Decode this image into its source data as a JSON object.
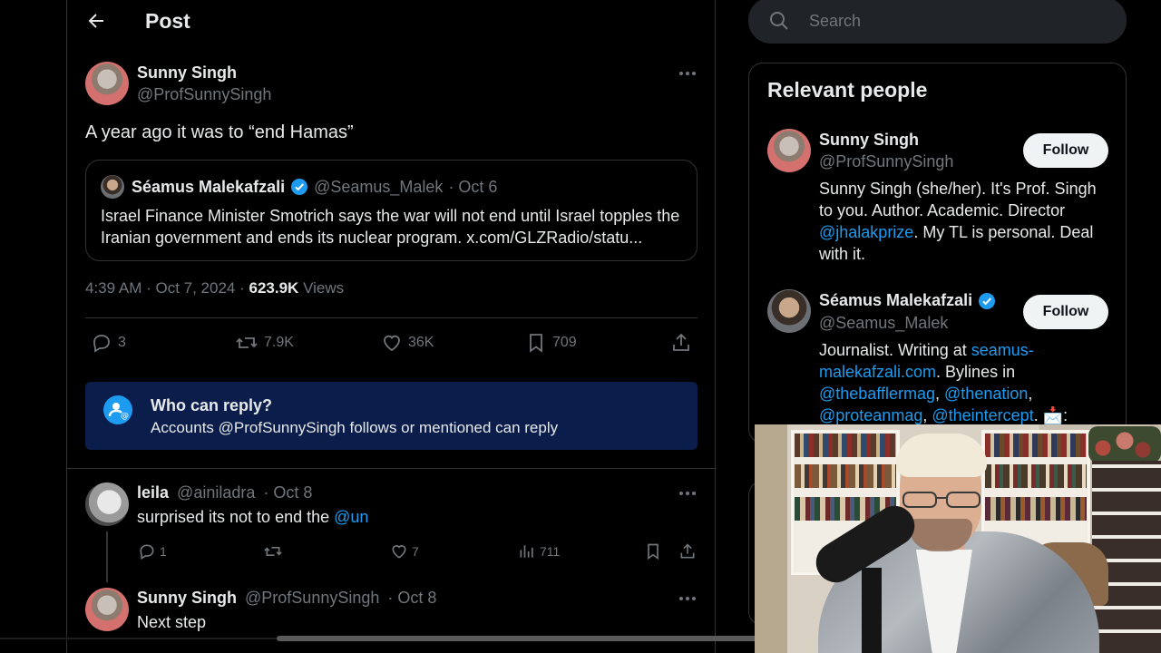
{
  "header": {
    "title": "Post"
  },
  "post": {
    "author_name": "Sunny Singh",
    "author_handle": "@ProfSunnySingh",
    "text": "A year ago it was to “end Hamas”",
    "quote": {
      "author_name": "Séamus Malekafzali",
      "author_handle": "@Seamus_Malek",
      "date": "· Oct 6",
      "text": "Israel Finance Minister Smotrich says the war will not end until Israel topples the Iranian government and ends its nuclear program. x.com/GLZRadio/statu..."
    },
    "time": "4:39 AM · Oct 7, 2024 ·",
    "views_count": "623.9K",
    "views_label": "Views",
    "stats": {
      "replies": "3",
      "reposts": "7.9K",
      "likes": "36K",
      "bookmarks": "709"
    }
  },
  "reply_restriction": {
    "title": "Who can reply?",
    "subtitle": "Accounts @ProfSunnySingh follows or mentioned can reply"
  },
  "replies": [
    {
      "name": "leila",
      "handle": "@ainiladra",
      "date": "· Oct 8",
      "text_prefix": "surprised its not to end the ",
      "mention": "@un",
      "stats": {
        "replies": "1",
        "reposts": "",
        "likes": "7",
        "views": "711"
      }
    },
    {
      "name": "Sunny Singh",
      "handle": "@ProfSunnySingh",
      "date": "· Oct 8",
      "text": "Next step"
    }
  ],
  "search": {
    "placeholder": "Search"
  },
  "relevant_people": {
    "title": "Relevant people",
    "follow_label": "Follow",
    "people": [
      {
        "name": "Sunny Singh",
        "handle": "@ProfSunnySingh",
        "bio_1": "Sunny Singh (she/her). It's Prof. Singh to you. Author. Academic. Director ",
        "bio_link": "@jhalakprize",
        "bio_2": ". My TL is personal. Deal with it."
      },
      {
        "name": "Séamus Malekafzali",
        "handle": "@Seamus_Malek",
        "bio_1": "Journalist. Writing at ",
        "bio_link": "seamus-malekafzali.com",
        "bio_2": ". Bylines in ",
        "bio_link_2": "@thebafflermag",
        "bio_sep_1": ", ",
        "bio_link_3": "@thenation",
        "bio_sep_2": ", ",
        "bio_link_4": "@proteanmag",
        "bio_sep_3": ", ",
        "bio_link_5": "@theintercept",
        "bio_3": ". 📩:"
      }
    ]
  },
  "colors": {
    "accent": "#1d9bf0",
    "background": "#000000",
    "muted": "#71767b",
    "reply_box": "#0b1d4a"
  }
}
